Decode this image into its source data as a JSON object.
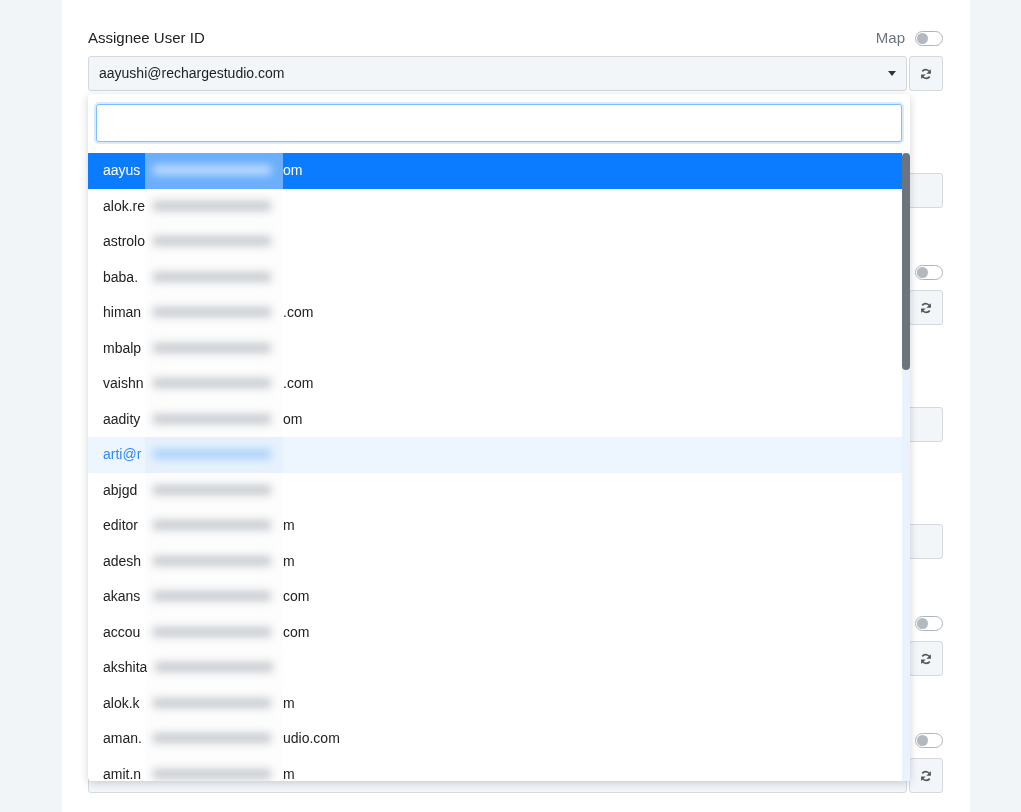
{
  "field": {
    "label": "Assignee User ID",
    "map_toggle": {
      "label": "Map",
      "on": false
    },
    "value": "aayushi@rechargestudio.com"
  },
  "dropdown": {
    "search": {
      "focused": true
    },
    "options": [
      {
        "start": "aayus",
        "end": "om",
        "selected": true,
        "hovered": false
      },
      {
        "start": "alok.re",
        "selected": false,
        "hovered": false
      },
      {
        "start": "astrolo",
        "selected": false,
        "hovered": false
      },
      {
        "start": "baba.",
        "selected": false,
        "hovered": false
      },
      {
        "start": "himan",
        "end": ".com",
        "selected": false,
        "hovered": false
      },
      {
        "start": "mbalp",
        "selected": false,
        "hovered": false
      },
      {
        "start": "vaishn",
        "end": ".com",
        "selected": false,
        "hovered": false
      },
      {
        "start": "aadity",
        "end": "om",
        "selected": false,
        "hovered": false
      },
      {
        "start": "arti@r",
        "selected": false,
        "hovered": true
      },
      {
        "start": "abjgd",
        "selected": false,
        "hovered": false
      },
      {
        "start": "editor",
        "end": "m",
        "selected": false,
        "hovered": false
      },
      {
        "start": "adesh",
        "end": "m",
        "selected": false,
        "hovered": false
      },
      {
        "start": "akans",
        "end": "com",
        "selected": false,
        "hovered": false
      },
      {
        "start": "accou",
        "end": "com",
        "selected": false,
        "hovered": false
      },
      {
        "start": "akshita",
        "selected": false,
        "hovered": false
      },
      {
        "start": "alok.k",
        "end": "m",
        "selected": false,
        "hovered": false
      },
      {
        "start": "aman.",
        "end": "udio.com",
        "selected": false,
        "hovered": false
      },
      {
        "start": "amit.n",
        "end": "m",
        "selected": false,
        "hovered": false
      }
    ]
  },
  "background_fields": [
    {
      "kind": "input"
    },
    {
      "kind": "refresh",
      "map_on": false
    },
    {
      "kind": "input"
    },
    {
      "kind": "input"
    },
    {
      "kind": "refresh",
      "map_on": false
    },
    {
      "kind": "select",
      "map_on": false
    }
  ]
}
